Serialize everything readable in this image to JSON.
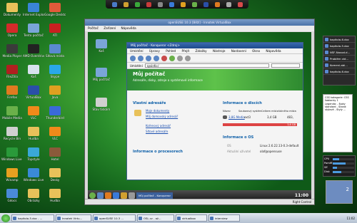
{
  "desktop": {
    "left_icons": [
      {
        "label": "Dokumenty",
        "icon": "folder-icon",
        "color": "#e8c15a"
      },
      {
        "label": "Internet Explorer",
        "icon": "ie-icon",
        "color": "#3a84d8"
      },
      {
        "label": "Google Desktop",
        "icon": "google-icon",
        "color": "#e05a3a"
      },
      {
        "label": "Opera",
        "icon": "opera-icon",
        "color": "#d42a2a"
      },
      {
        "label": "Tento počítač",
        "icon": "computer-icon",
        "color": "#7aa5d8"
      },
      {
        "label": "ATI",
        "icon": "ati-icon",
        "color": "#c82020"
      },
      {
        "label": "Media Player",
        "icon": "media-icon",
        "color": "#3a3a3a"
      },
      {
        "label": "AMD Overdrive",
        "icon": "amd-icon",
        "color": "#222"
      },
      {
        "label": "Síťová místa",
        "icon": "network-icon",
        "color": "#5a8ad0"
      },
      {
        "label": "FileZilla",
        "icon": "filezilla-icon",
        "color": "#b02020"
      },
      {
        "label": "Koš",
        "icon": "trash-icon",
        "color": "#d8e2ee"
      },
      {
        "label": "Skype",
        "icon": "skype-icon",
        "color": "#2aa8e8"
      },
      {
        "label": "Firefox",
        "icon": "firefox-icon",
        "color": "#e07a20"
      },
      {
        "label": "VirtualBox",
        "icon": "virtualbox-icon",
        "color": "#2a4fa8"
      },
      {
        "label": "Java",
        "icon": "java-icon",
        "color": "#e0a020"
      },
      {
        "label": "Mobile Media",
        "icon": "mobile-icon",
        "color": "#6ab04a"
      },
      {
        "label": "VLC",
        "icon": "vlc-icon",
        "color": "#f08a1a"
      },
      {
        "label": "Thunderbird",
        "icon": "thunderbird-icon",
        "color": "#3a6ad8"
      },
      {
        "label": "Recycle Bin",
        "icon": "recycle-icon",
        "color": "#d0d0d0"
      },
      {
        "label": "Hudba",
        "icon": "music-icon",
        "color": "#e8c15a"
      },
      {
        "label": "VLC",
        "icon": "vlc-icon",
        "color": "#f08a1a"
      },
      {
        "label": "Windows Live Messenger",
        "icon": "messenger-icon",
        "color": "#2a9a3a"
      },
      {
        "label": "Topstyle",
        "icon": "topstyle-icon",
        "color": "#3aa8d8"
      },
      {
        "label": "Hotel",
        "icon": "hotel-icon",
        "color": "#8a5a3a"
      },
      {
        "label": "Winamp",
        "icon": "winamp-icon",
        "color": "#e8a020"
      },
      {
        "label": "Windows Live",
        "icon": "live-icon",
        "color": "#3a8ad8"
      },
      {
        "label": "Desky",
        "icon": "folder-icon",
        "color": "#e8c15a"
      },
      {
        "label": "Gdocs",
        "icon": "docs-icon",
        "color": "#4a8ad8"
      },
      {
        "label": "Obrázky",
        "icon": "folder-icon",
        "color": "#e8c15a"
      },
      {
        "label": "Hudba",
        "icon": "folder-icon",
        "color": "#e8c15a"
      }
    ]
  },
  "vbox": {
    "title": "openSUSE 10.3 [Běží] - Innotek VirtualBox",
    "menu": [
      "Počítač",
      "Zařízení",
      "Nápověda"
    ],
    "status": "Right Control"
  },
  "guest": {
    "icons": [
      {
        "label": "Koš",
        "icon": "trash-icon",
        "color": "#7aa5d8"
      },
      {
        "label": "Můj počítač",
        "icon": "computer-icon",
        "color": "#7aa5d8"
      },
      {
        "label": "Stav tiskárn",
        "icon": "printer-icon",
        "color": "#d0d0d0"
      }
    ],
    "taskbar_button": "Můj počítač - Konqueror",
    "clock": "11:00"
  },
  "konqueror": {
    "title": "Můj počítač - Konqueror <Zdroj>",
    "menu": [
      "Umístění",
      "Úpravy",
      "Pohled",
      "Přejít",
      "Záložky",
      "Nástroje",
      "Nastavení",
      "Okno",
      "Nápověda"
    ],
    "location_label": "Umístění",
    "location_value": "sysinfo:/",
    "banner_title": "Můj počítač",
    "banner_subtitle": "Adresáře, disky, zdroje a systémové informace",
    "own_folders_title": "Vlastní adresáře",
    "own_folders": [
      "Moje dokumenty",
      "Můj domovský adresář",
      "Kořenový adresář",
      "Síťové adresáře"
    ],
    "disks_title": "Informace o discích",
    "disk_headers": [
      "Název",
      "Souborový systém",
      "Celkem místa",
      "Volného místa"
    ],
    "disk_row": {
      "name": "3,8G Media",
      "fs": "ext3",
      "total": "3,4 GB",
      "free": "483,"
    },
    "disk_bar_text": "3,6 GB",
    "os_title": "Informace o OS",
    "os_rows": [
      {
        "label": "OS",
        "value": "Linux 2.6.22.13-0.3-default"
      },
      {
        "label": "Aktuální uživatel",
        "value": "olaf@opensuse"
      }
    ],
    "cpu_title": "Informace o procesorech"
  },
  "sidebar_notes": [
    "kapitola-6.doc",
    "kapitola-5.doc",
    "NSF-Navod.d...",
    "Problém vid...",
    "Komeni-abl...",
    "kapitola-6.doc"
  ],
  "css_note": "CSS kategorie: CSS šablonky 1 Legenda: - šipky standard - Stand: stylové - Styly ...",
  "sysmon": {
    "rows": [
      {
        "label": "CPU",
        "value": 0.3
      },
      {
        "label": "Paměť",
        "value": 0.6
      },
      {
        "label": "Síť",
        "value": 0.2
      },
      {
        "label": "Disk",
        "value": 0.4
      }
    ]
  },
  "pager_number": "2",
  "host_taskbar": {
    "items": [
      "kapitola-5.doc - ...",
      "Innotek Virtu...",
      "openSUSE 10.3 ...",
      "OSL.cz - až...",
      "virtualbox",
      "interview"
    ],
    "clock": "11:02"
  }
}
